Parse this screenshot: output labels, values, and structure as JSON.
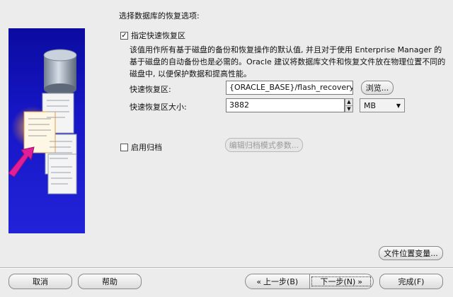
{
  "heading": "选择数据库的恢复选项:",
  "flash_recovery": {
    "checkbox_label": "指定快速恢复区",
    "checked": true,
    "description": "该值用作所有基于磁盘的备份和恢复操作的默认值, 并且对于使用 Enterprise Manager 的基于磁盘的自动备份也是必需的。Oracle 建议将数据库文件和恢复文件放在物理位置不同的磁盘中, 以便保护数据和提高性能。",
    "location_label": "快速恢复区:",
    "location_value": "{ORACLE_BASE}/flash_recovery_area",
    "browse_button": "浏览...",
    "size_label": "快速恢复区大小:",
    "size_value": "3882",
    "size_unit": "MB"
  },
  "archiving": {
    "checkbox_label": "启用归档",
    "checked": false,
    "params_button": "编辑归档模式参数..."
  },
  "file_location_button": "文件位置变量...",
  "footer": {
    "cancel": "取消",
    "help": "帮助",
    "back": "上一步(B)",
    "next": "下一步(N)",
    "finish": "完成(F)"
  }
}
